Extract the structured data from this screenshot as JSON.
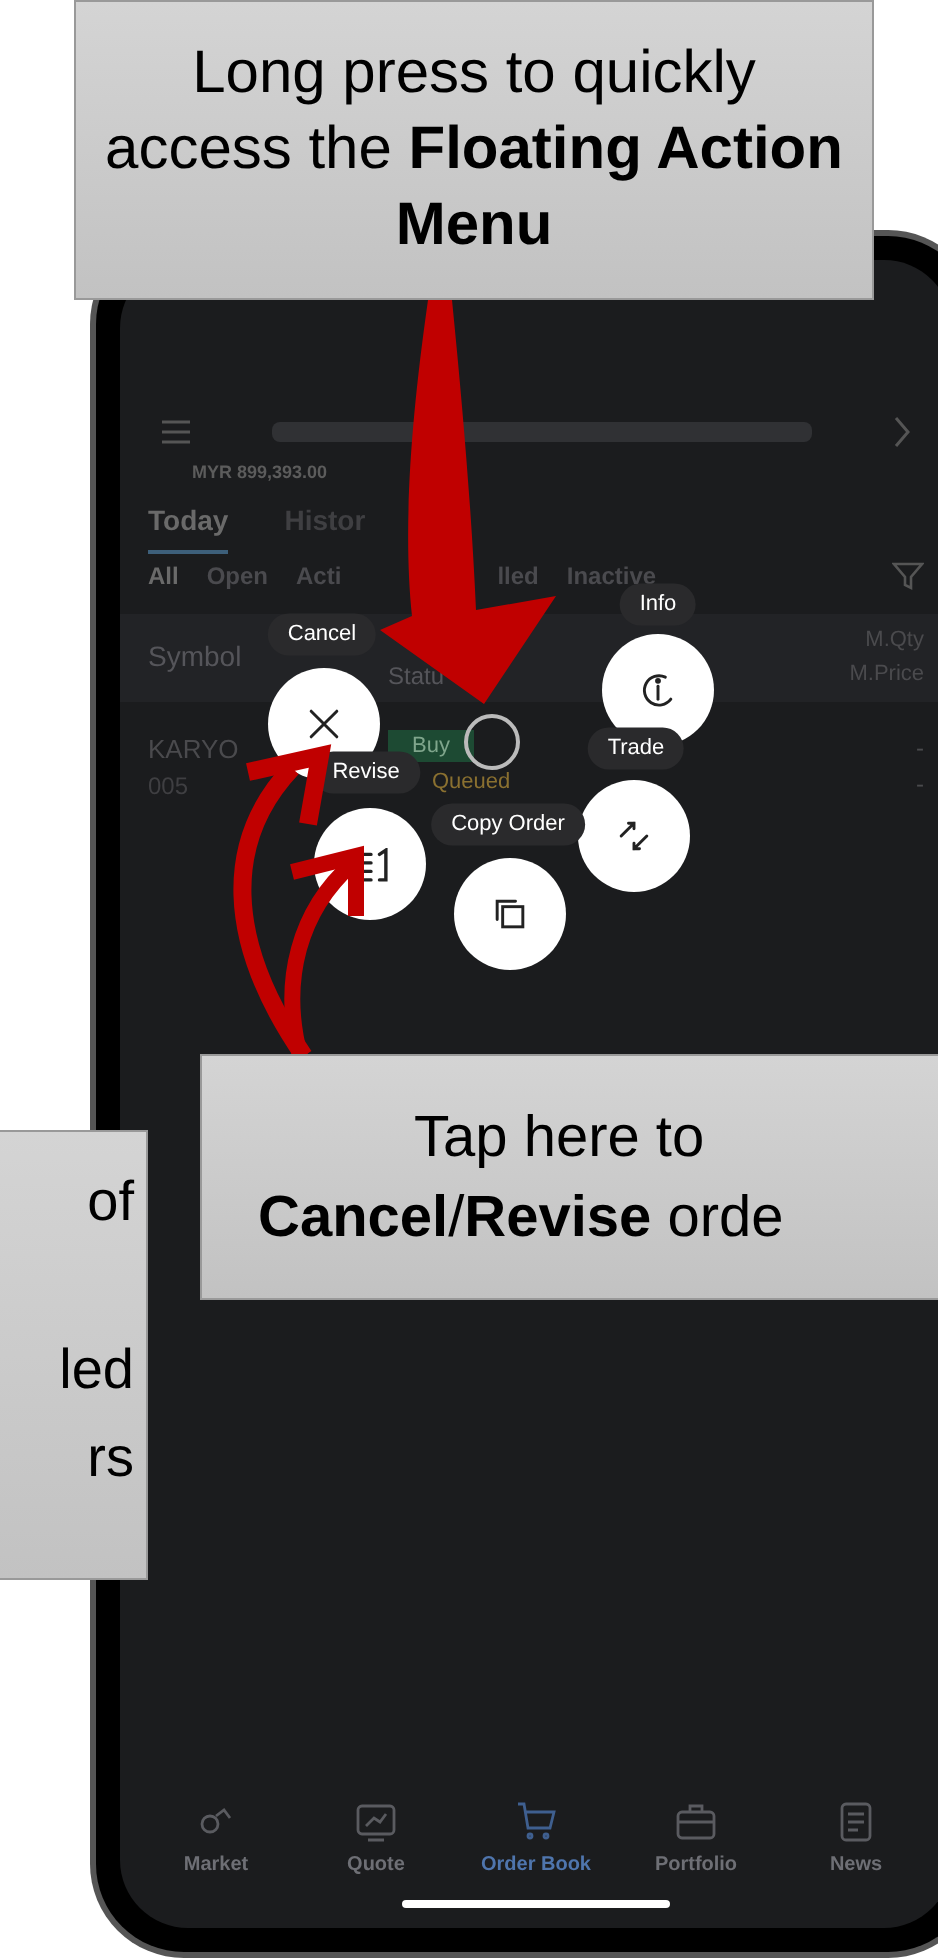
{
  "top_callout": {
    "text": "Long press to quickly access the **Floating Action Menu**"
  },
  "left_callout": {
    "lines": [
      "of",
      "led",
      "rs"
    ]
  },
  "bottom_callout": {
    "lines": [
      "Tap here to",
      "**Cancel**/**Revise** orde"
    ]
  },
  "header": {
    "balance": "MYR 899,393.00"
  },
  "tabs": [
    {
      "label": "Today",
      "selected": true
    },
    {
      "label": "Histor",
      "selected": false
    }
  ],
  "filters": [
    {
      "label": "All",
      "selected": true
    },
    {
      "label": "Open",
      "selected": false
    },
    {
      "label": "Acti",
      "selected": false
    },
    {
      "label": "lled",
      "selected": false
    },
    {
      "label": "Inactive",
      "selected": false
    }
  ],
  "table": {
    "columns": {
      "symbol": "Symbol",
      "status": "Statu",
      "qty": "M.Qty",
      "price": "M.Price"
    },
    "rows": [
      {
        "symbol": "KARYO",
        "code": "005",
        "side": "Buy",
        "status": "Queued",
        "qty": "-",
        "price": "-"
      }
    ]
  },
  "fab_menu": {
    "actions": [
      {
        "label": "Cancel",
        "kind": "cancel"
      },
      {
        "label": "Info",
        "kind": "info"
      },
      {
        "label": "Revise",
        "kind": "revise"
      },
      {
        "label": "Trade",
        "kind": "trade"
      },
      {
        "label": "Copy Order",
        "kind": "copy"
      }
    ]
  },
  "bottom_nav": [
    {
      "label": "Market",
      "kind": "market",
      "selected": false
    },
    {
      "label": "Quote",
      "kind": "quote",
      "selected": false
    },
    {
      "label": "Order Book",
      "kind": "orderbook",
      "selected": true
    },
    {
      "label": "Portfolio",
      "kind": "portfolio",
      "selected": false
    },
    {
      "label": "News",
      "kind": "news",
      "selected": false
    }
  ]
}
